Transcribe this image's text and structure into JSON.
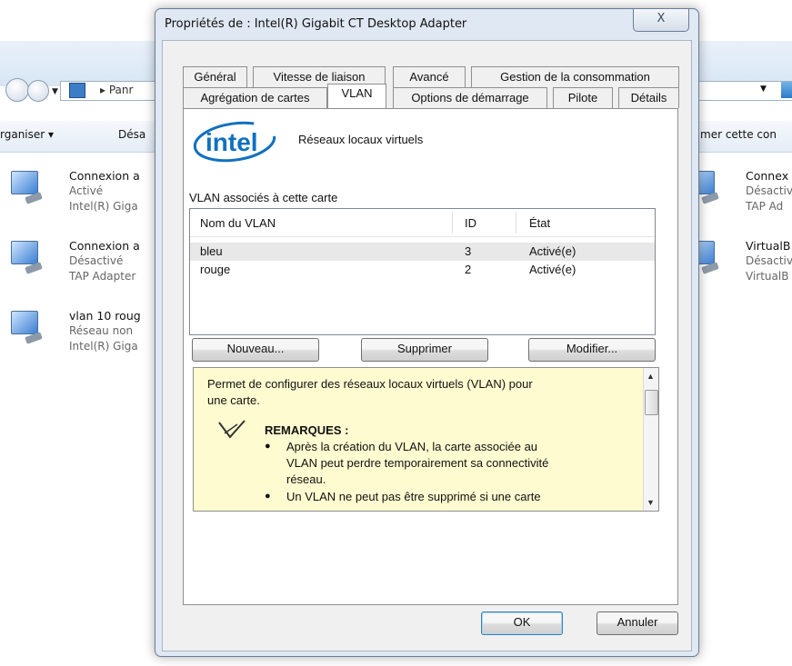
{
  "background": {
    "address_crumb": "Panr",
    "toolbar": {
      "organize": "rganiser",
      "disable": "Désa",
      "right": "mer cette con"
    },
    "connections_left": [
      {
        "name": "Connexion a",
        "status": "Activé",
        "device": "Intel(R) Giga"
      },
      {
        "name": "Connexion a",
        "status": "Désactivé",
        "device": "TAP Adapter"
      },
      {
        "name": "vlan 10 roug",
        "status": "Réseau non",
        "device": "Intel(R) Giga"
      }
    ],
    "connections_right": [
      {
        "name": "Connex",
        "status": "Désactiv",
        "device": "TAP Ad"
      },
      {
        "name": "VirtualB",
        "status": "Désactiv",
        "device": "VirtualB"
      }
    ]
  },
  "dialog": {
    "title": "Propriétés de : Intel(R) Gigabit CT Desktop Adapter",
    "close_glyph": "X",
    "tabs_row1": [
      "Général",
      "Vitesse de liaison",
      "Avancé",
      "Gestion de la consommation"
    ],
    "tabs_row2": [
      "Agrégation de cartes",
      "VLAN",
      "Options de démarrage",
      "Pilote",
      "Détails"
    ],
    "active_tab": "VLAN",
    "logo_text": "intel",
    "panel_title": "Réseaux locaux virtuels",
    "section_label": "VLAN associés à cette carte",
    "table": {
      "columns": [
        "Nom du VLAN",
        "ID",
        "État"
      ],
      "rows": [
        {
          "name": "bleu",
          "id": "3",
          "state": "Activé(e)",
          "selected": true
        },
        {
          "name": "rouge",
          "id": "2",
          "state": "Activé(e)",
          "selected": false
        }
      ]
    },
    "buttons": {
      "new": "Nouveau...",
      "delete": "Supprimer",
      "modify": "Modifier...",
      "ok": "OK",
      "cancel": "Annuler"
    },
    "help": {
      "intro_line1": "Permet de configurer des réseaux locaux virtuels (VLAN) pour",
      "intro_line2": "une carte.",
      "remarks_heading": "REMARQUES :",
      "bullet1": [
        "Après la création du VLAN, la carte associée au",
        "VLAN peut perdre temporairement sa connectivité",
        "réseau."
      ],
      "bullet2": "Un VLAN ne peut pas être supprimé si une carte"
    }
  },
  "colors": {
    "intel_blue": "#1070c0",
    "help_bg": "#fffbd0"
  }
}
